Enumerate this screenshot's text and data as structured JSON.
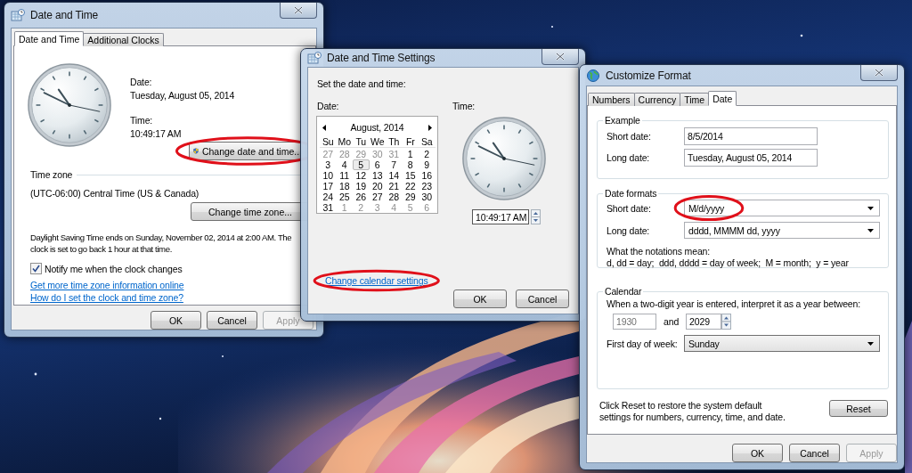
{
  "date_and_time": {
    "title": "Date and Time",
    "tabs": [
      {
        "label": "Date and Time",
        "selected": true
      },
      {
        "label": "Additional Clocks",
        "selected": false
      }
    ],
    "date_label": "Date:",
    "date": "Tuesday, August 05, 2014",
    "time_label": "Time:",
    "time": "10:49:17 AM",
    "change_datetime_button": {
      "label": "Change date and time...",
      "circled": true
    },
    "time_zone_heading": "Time zone",
    "time_zone": "(UTC-06:00) Central Time (US & Canada)",
    "change_time_zone_button": {
      "label": "Change time zone..."
    },
    "dst_lines": [
      "Daylight Saving Time ends on Sunday, November 02, 2014 at 2:00 AM. The",
      "clock is set to go back 1 hour at that time."
    ],
    "notify": {
      "label": "Notify me when the clock changes",
      "checked": true
    },
    "links": [
      "Get more time zone information online",
      "How do I set the clock and time zone?"
    ],
    "buttons": [
      {
        "label": "OK",
        "disabled": false
      },
      {
        "label": "Cancel",
        "disabled": false
      },
      {
        "label": "Apply",
        "disabled": true
      }
    ]
  },
  "date_time_settings": {
    "title": "Date and Time Settings",
    "prompt": "Set the date and time:",
    "date_label": "Date:",
    "time_label": "Time:",
    "calendar": {
      "month": "August, 2014",
      "weekdays": [
        "Su",
        "Mo",
        "Tu",
        "We",
        "Th",
        "Fr",
        "Sa"
      ],
      "weeks": [
        [
          {
            "day": "27",
            "other_month": true,
            "selected": false
          },
          {
            "day": "28",
            "other_month": true,
            "selected": false
          },
          {
            "day": "29",
            "other_month": true,
            "selected": false
          },
          {
            "day": "30",
            "other_month": true,
            "selected": false
          },
          {
            "day": "31",
            "other_month": true,
            "selected": false
          },
          {
            "day": "1",
            "other_month": false,
            "selected": false
          },
          {
            "day": "2",
            "other_month": false,
            "selected": false
          }
        ],
        [
          {
            "day": "3",
            "other_month": false,
            "selected": false
          },
          {
            "day": "4",
            "other_month": false,
            "selected": false
          },
          {
            "day": "5",
            "other_month": false,
            "selected": true
          },
          {
            "day": "6",
            "other_month": false,
            "selected": false
          },
          {
            "day": "7",
            "other_month": false,
            "selected": false
          },
          {
            "day": "8",
            "other_month": false,
            "selected": false
          },
          {
            "day": "9",
            "other_month": false,
            "selected": false
          }
        ],
        [
          {
            "day": "10",
            "other_month": false,
            "selected": false
          },
          {
            "day": "11",
            "other_month": false,
            "selected": false
          },
          {
            "day": "12",
            "other_month": false,
            "selected": false
          },
          {
            "day": "13",
            "other_month": false,
            "selected": false
          },
          {
            "day": "14",
            "other_month": false,
            "selected": false
          },
          {
            "day": "15",
            "other_month": false,
            "selected": false
          },
          {
            "day": "16",
            "other_month": false,
            "selected": false
          }
        ],
        [
          {
            "day": "17",
            "other_month": false,
            "selected": false
          },
          {
            "day": "18",
            "other_month": false,
            "selected": false
          },
          {
            "day": "19",
            "other_month": false,
            "selected": false
          },
          {
            "day": "20",
            "other_month": false,
            "selected": false
          },
          {
            "day": "21",
            "other_month": false,
            "selected": false
          },
          {
            "day": "22",
            "other_month": false,
            "selected": false
          },
          {
            "day": "23",
            "other_month": false,
            "selected": false
          }
        ],
        [
          {
            "day": "24",
            "other_month": false,
            "selected": false
          },
          {
            "day": "25",
            "other_month": false,
            "selected": false
          },
          {
            "day": "26",
            "other_month": false,
            "selected": false
          },
          {
            "day": "27",
            "other_month": false,
            "selected": false
          },
          {
            "day": "28",
            "other_month": false,
            "selected": false
          },
          {
            "day": "29",
            "other_month": false,
            "selected": false
          },
          {
            "day": "30",
            "other_month": false,
            "selected": false
          }
        ],
        [
          {
            "day": "31",
            "other_month": false,
            "selected": false
          },
          {
            "day": "1",
            "other_month": true,
            "selected": false
          },
          {
            "day": "2",
            "other_month": true,
            "selected": false
          },
          {
            "day": "3",
            "other_month": true,
            "selected": false
          },
          {
            "day": "4",
            "other_month": true,
            "selected": false
          },
          {
            "day": "5",
            "other_month": true,
            "selected": false
          },
          {
            "day": "6",
            "other_month": true,
            "selected": false
          }
        ]
      ]
    },
    "time": "10:49:17 AM",
    "link": {
      "label": "Change calendar settings",
      "circled": true
    },
    "buttons": [
      {
        "label": "OK",
        "disabled": false
      },
      {
        "label": "Cancel",
        "disabled": false
      }
    ]
  },
  "customize_format": {
    "title": "Customize Format",
    "tabs": [
      {
        "label": "Numbers",
        "selected": false
      },
      {
        "label": "Currency",
        "selected": false
      },
      {
        "label": "Time",
        "selected": false
      },
      {
        "label": "Date",
        "selected": true
      }
    ],
    "example": {
      "heading": "Example",
      "rows": [
        {
          "label": "Short date:",
          "value": "8/5/2014"
        },
        {
          "label": "Long date:",
          "value": "Tuesday, August 05, 2014"
        }
      ]
    },
    "date_formats": {
      "heading": "Date formats",
      "rows": [
        {
          "label": "Short date:",
          "value": "M/d/yyyy",
          "circled": true
        },
        {
          "label": "Long date:",
          "value": "dddd, MMMM dd, yyyy",
          "circled": false
        }
      ],
      "notes": [
        "What the notations mean:",
        "d, dd = day;  ddd, dddd = day of week;  M = month;  y = year"
      ]
    },
    "calendar": {
      "heading": "Calendar",
      "prompt": "When a two-digit year is entered, interpret it as a year between:",
      "from_year": {
        "value": "1930",
        "disabled": true
      },
      "and_label": "and",
      "to_year": {
        "value": "2029",
        "disabled": false
      },
      "first_day_label": "First day of week:",
      "first_day": "Sunday"
    },
    "reset_text": "Click Reset to restore the system default settings for numbers, currency, time, and date.",
    "reset_button": "Reset",
    "buttons": [
      {
        "label": "OK",
        "disabled": false
      },
      {
        "label": "Cancel",
        "disabled": false
      },
      {
        "label": "Apply",
        "disabled": true
      }
    ]
  }
}
